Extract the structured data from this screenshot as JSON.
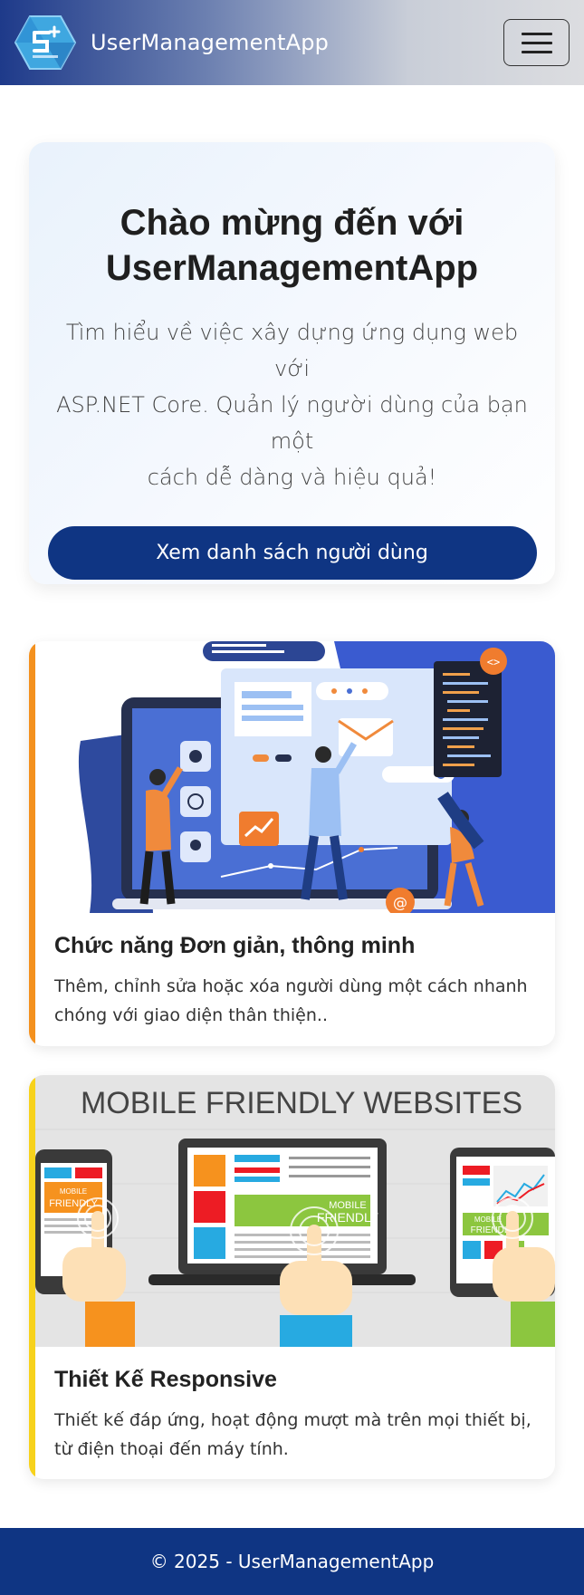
{
  "navbar": {
    "brand": "UserManagementApp",
    "toggle_icon": "hamburger-icon",
    "logo_icon": "app-logo"
  },
  "hero": {
    "title_line1": "Chào mừng đến với",
    "title_line2": "UserManagementApp",
    "description_line1": "Tìm hiểu về việc xây dựng ứng dụng web với",
    "description_line2": "ASP.NET Core. Quản lý người dùng của bạn một",
    "description_line3": "cách dễ dàng và hiệu quả!",
    "button_label": "Xem danh sách người dùng"
  },
  "features": [
    {
      "title": "Chức năng Đơn giản, thông minh",
      "description_line1": "Thêm, chỉnh sửa hoặc xóa người dùng một cách nhanh",
      "description_line2": "chóng với giao diện thân thiện..",
      "accent_color": "#f4911e",
      "illustration": "web-app-illustration"
    },
    {
      "title": "Thiết Kế Responsive",
      "description_line1": "Thiết kế đáp ứng, hoạt động mượt mà trên mọi thiết bị,",
      "description_line2": "từ điện thoại đến máy tính.",
      "accent_color": "#f7d21c",
      "illustration": "mobile-friendly-illustration",
      "banner": {
        "heading": "MOBILE FRIENDLY WEBSITES",
        "screen_label_top": "MOBILE",
        "screen_label_bottom": "FRIENDLY"
      }
    }
  ],
  "footer": {
    "copyright": "© 2025 - UserManagementApp"
  },
  "colors": {
    "primary": "#0f3583",
    "navbar_start": "#1e3a8a",
    "accent_orange": "#f4911e",
    "accent_yellow": "#f7d21c"
  }
}
